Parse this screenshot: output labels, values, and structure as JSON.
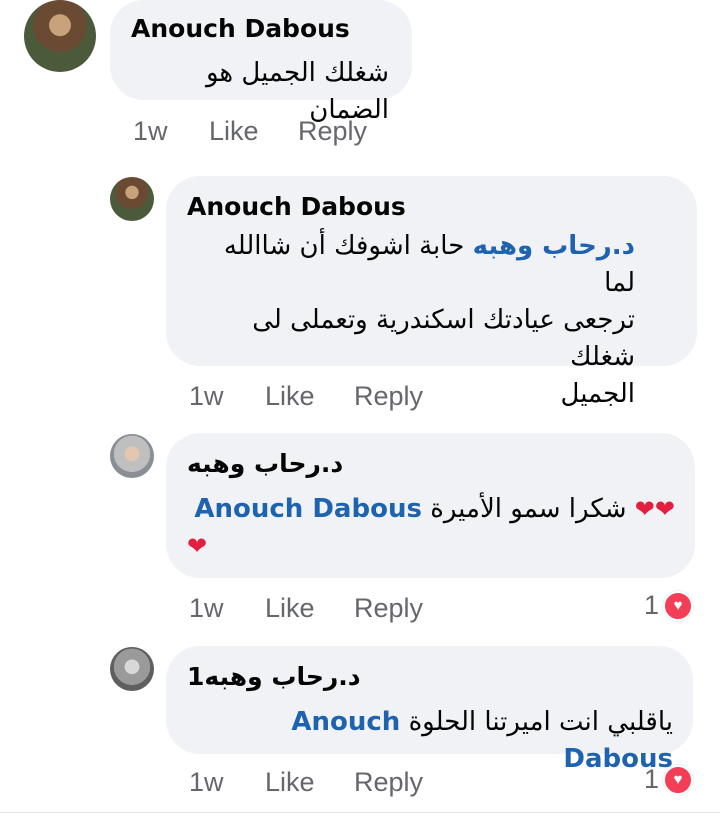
{
  "comments": [
    {
      "author": "Anouch Dabous",
      "text": "شغلك الجميل هو الضمان",
      "time": "1w",
      "like": "Like",
      "reply": "Reply"
    },
    {
      "author": "Anouch Dabous",
      "mention": "د.رحاب وهبه",
      "text_line1": "حابة اشوفك أن شاالله لما",
      "text_line2": "ترجعى عيادتك اسكندرية وتعملى لى شغلك",
      "text_line3": "الجميل",
      "time": "1w",
      "like": "Like",
      "reply": "Reply"
    },
    {
      "author": "د.رحاب وهبه",
      "mention": "Anouch Dabous",
      "text": "شكرا سمو الأميرة",
      "time": "1w",
      "like": "Like",
      "reply": "Reply",
      "reaction_count": "1"
    },
    {
      "author": "د.رحاب وهبه1",
      "mention": "Anouch Dabous",
      "text": "ياقلبي انت اميرتنا الحلوة",
      "time": "1w",
      "like": "Like",
      "reply": "Reply",
      "reaction_count": "1"
    }
  ],
  "colors": {
    "bubble": "#f0f2f5",
    "mention": "#1e63b0",
    "meta": "#65676b",
    "heart": "#e41e3f",
    "reaction": "#f33e58"
  },
  "icons": {
    "heart": "heart-emoji-icon",
    "love_reaction": "love-reaction-icon"
  }
}
